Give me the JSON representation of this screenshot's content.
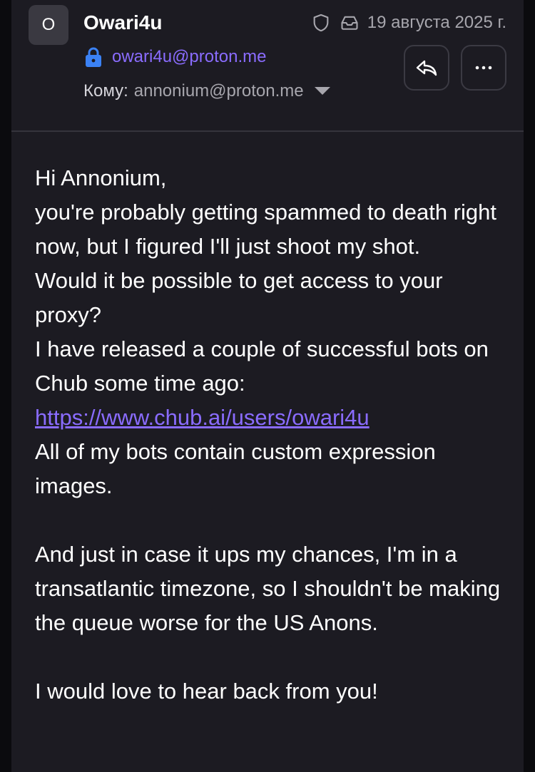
{
  "header": {
    "avatar_letter": "O",
    "sender_name": "Owari4u",
    "sender_email": "owari4u@proton.me",
    "date": "19 августа 2025 г.",
    "to_label": "Кому:",
    "to_address": "annonium@proton.me",
    "icons": {
      "shield": "shield-icon",
      "inbox": "inbox-icon",
      "lock": "lock-icon",
      "caret": "chevron-down-icon",
      "reply": "reply-icon",
      "more": "more-icon"
    },
    "more_label": "···"
  },
  "colors": {
    "background": "#1c1b22",
    "accent": "#8a6cff",
    "lock": "#3b82f6",
    "muted": "#a7a6ad"
  },
  "message": {
    "line1": "Hi Annonium,",
    "line2": "you're probably getting spammed to death right now, but I figured I'll just shoot my shot.",
    "line3": "Would it be possible to get access to your proxy?",
    "line4": "I have released a couple of successful bots on Chub some time ago:",
    "link": "https://www.chub.ai/users/owari4u",
    "line5": "All of my bots contain custom expression images.",
    "line6": "And just in case it ups my chances, I'm in a transatlantic timezone, so I shouldn't be making the queue worse for the US Anons.",
    "line7": "I would love to hear back from you!"
  }
}
